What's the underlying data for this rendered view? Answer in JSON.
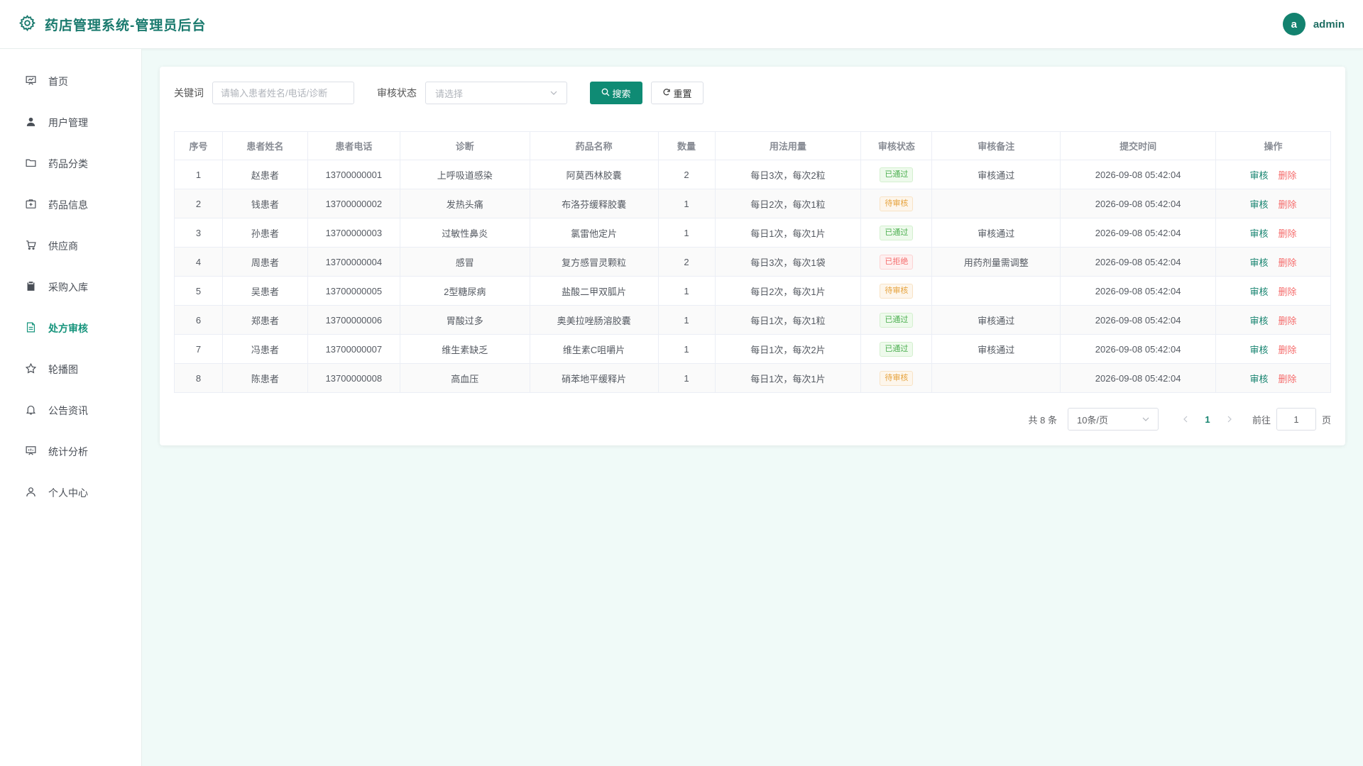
{
  "app": {
    "title": "药店管理系统-管理员后台"
  },
  "user": {
    "avatar_letter": "a",
    "name": "admin"
  },
  "sidebar": {
    "items": [
      {
        "label": "首页",
        "icon": "presentation-icon"
      },
      {
        "label": "用户管理",
        "icon": "user-icon"
      },
      {
        "label": "药品分类",
        "icon": "folder-icon"
      },
      {
        "label": "药品信息",
        "icon": "medical-kit-icon"
      },
      {
        "label": "供应商",
        "icon": "cart-icon"
      },
      {
        "label": "采购入库",
        "icon": "clipboard-icon"
      },
      {
        "label": "处方审核",
        "icon": "document-icon",
        "active": true
      },
      {
        "label": "轮播图",
        "icon": "star-icon"
      },
      {
        "label": "公告资讯",
        "icon": "bell-icon"
      },
      {
        "label": "统计分析",
        "icon": "chart-board-icon"
      },
      {
        "label": "个人中心",
        "icon": "person-icon"
      }
    ]
  },
  "search": {
    "keyword_label": "关键词",
    "keyword_placeholder": "请输入患者姓名/电话/诊断",
    "status_label": "审核状态",
    "status_placeholder": "请选择",
    "search_button": "搜索",
    "reset_button": "重置"
  },
  "table": {
    "headers": [
      "序号",
      "患者姓名",
      "患者电话",
      "诊断",
      "药品名称",
      "数量",
      "用法用量",
      "审核状态",
      "审核备注",
      "提交时间",
      "操作"
    ],
    "rows": [
      {
        "no": "1",
        "name": "赵患者",
        "phone": "13700000001",
        "diagnosis": "上呼吸道感染",
        "drug": "阿莫西林胶囊",
        "qty": "2",
        "usage": "每日3次，每次2粒",
        "status": "已通过",
        "status_type": "pass",
        "remark": "审核通过",
        "time": "2026-09-08 05:42:04"
      },
      {
        "no": "2",
        "name": "钱患者",
        "phone": "13700000002",
        "diagnosis": "发热头痛",
        "drug": "布洛芬缓释胶囊",
        "qty": "1",
        "usage": "每日2次，每次1粒",
        "status": "待审核",
        "status_type": "pending",
        "remark": "",
        "time": "2026-09-08 05:42:04"
      },
      {
        "no": "3",
        "name": "孙患者",
        "phone": "13700000003",
        "diagnosis": "过敏性鼻炎",
        "drug": "氯雷他定片",
        "qty": "1",
        "usage": "每日1次，每次1片",
        "status": "已通过",
        "status_type": "pass",
        "remark": "审核通过",
        "time": "2026-09-08 05:42:04"
      },
      {
        "no": "4",
        "name": "周患者",
        "phone": "13700000004",
        "diagnosis": "感冒",
        "drug": "复方感冒灵颗粒",
        "qty": "2",
        "usage": "每日3次，每次1袋",
        "status": "已拒绝",
        "status_type": "reject",
        "remark": "用药剂量需调整",
        "time": "2026-09-08 05:42:04"
      },
      {
        "no": "5",
        "name": "吴患者",
        "phone": "13700000005",
        "diagnosis": "2型糖尿病",
        "drug": "盐酸二甲双胍片",
        "qty": "1",
        "usage": "每日2次，每次1片",
        "status": "待审核",
        "status_type": "pending",
        "remark": "",
        "time": "2026-09-08 05:42:04"
      },
      {
        "no": "6",
        "name": "郑患者",
        "phone": "13700000006",
        "diagnosis": "胃酸过多",
        "drug": "奥美拉唑肠溶胶囊",
        "qty": "1",
        "usage": "每日1次，每次1粒",
        "status": "已通过",
        "status_type": "pass",
        "remark": "审核通过",
        "time": "2026-09-08 05:42:04"
      },
      {
        "no": "7",
        "name": "冯患者",
        "phone": "13700000007",
        "diagnosis": "维生素缺乏",
        "drug": "维生素C咀嚼片",
        "qty": "1",
        "usage": "每日1次，每次2片",
        "status": "已通过",
        "status_type": "pass",
        "remark": "审核通过",
        "time": "2026-09-08 05:42:04"
      },
      {
        "no": "8",
        "name": "陈患者",
        "phone": "13700000008",
        "diagnosis": "高血压",
        "drug": "硝苯地平缓释片",
        "qty": "1",
        "usage": "每日1次，每次1片",
        "status": "待审核",
        "status_type": "pending",
        "remark": "",
        "time": "2026-09-08 05:42:04"
      }
    ],
    "actions": {
      "audit": "审核",
      "delete": "删除"
    }
  },
  "pagination": {
    "total_text": "共 8 条",
    "page_size": "10条/页",
    "current_page": "1",
    "goto_label": "前往",
    "goto_value": "1",
    "page_suffix": "页"
  },
  "colors": {
    "brand": "#1a7a6e",
    "primary": "#0f8b74",
    "danger": "#f56c6c",
    "warning": "#e6a23c",
    "success": "#4caf50"
  }
}
